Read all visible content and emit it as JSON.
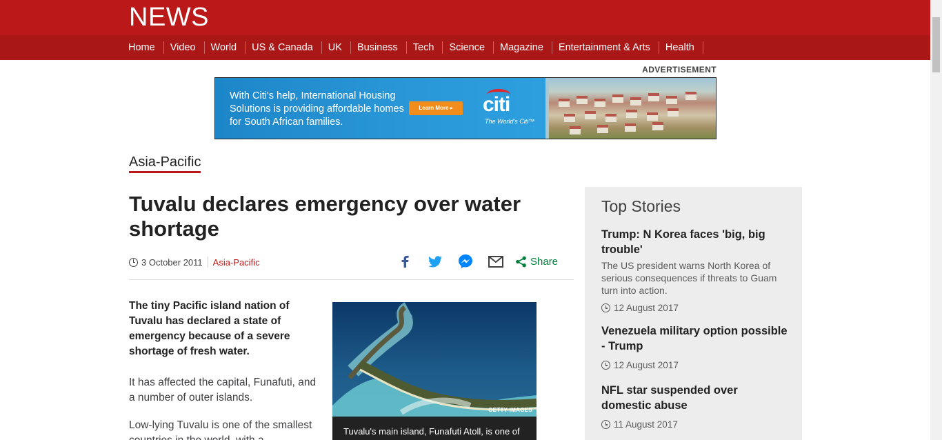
{
  "header": {
    "logo": "NEWS",
    "nav": [
      "Home",
      "Video",
      "World",
      "US & Canada",
      "UK",
      "Business",
      "Tech",
      "Science",
      "Magazine",
      "Entertainment & Arts",
      "Health"
    ]
  },
  "ad": {
    "label": "ADVERTISEMENT",
    "text": "With Citi's help, International Housing Solutions is providing affordable homes for South African families.",
    "button": "Learn More ▸",
    "brand": "citi",
    "tagline": "The World's Citi™"
  },
  "article": {
    "section": "Asia-Pacific",
    "headline": "Tuvalu declares emergency over water shortage",
    "date": "3 October 2011",
    "section_link": "Asia-Pacific",
    "share_label": "Share",
    "share_icons": [
      "facebook-icon",
      "twitter-icon",
      "messenger-icon",
      "email-icon",
      "share-icon"
    ],
    "intro": "The tiny Pacific island nation of Tuvalu has declared a state of emergency because of a severe shortage of fresh water.",
    "paragraphs": [
      "It has affected the capital, Funafuti, and a number of outer islands.",
      "Low-lying Tuvalu is one of the smallest countries in the world, with a"
    ],
    "figure": {
      "credit": "GETTY IMAGES",
      "caption": "Tuvalu's main island, Funafuti Atoll, is one of"
    }
  },
  "sidebar": {
    "title": "Top Stories",
    "stories": [
      {
        "headline": "Trump: N Korea faces 'big, big trouble'",
        "summary": "The US president warns North Korea of serious consequences if threats to Guam turn into action.",
        "date": "12 August 2017"
      },
      {
        "headline": "Venezuela military option possible - Trump",
        "summary": "",
        "date": "12 August 2017"
      },
      {
        "headline": "NFL star suspended over domestic abuse",
        "summary": "",
        "date": "11 August 2017"
      }
    ]
  },
  "colors": {
    "brand_red": "#bb1919",
    "nav_red": "#a91717",
    "share_green": "#007f3b",
    "sidebar_bg": "#ededed"
  }
}
